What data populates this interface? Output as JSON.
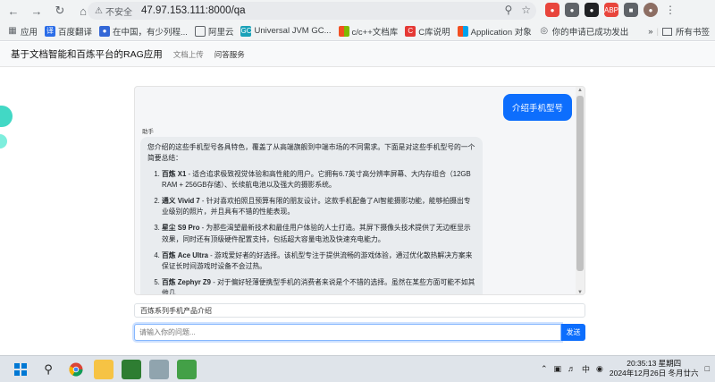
{
  "browser": {
    "insecure_label": "不安全",
    "url": "47.97.153.111:8000/qa"
  },
  "bookmarks": {
    "items": [
      {
        "label": "应用"
      },
      {
        "label": "百度翻译"
      },
      {
        "label": "在中国，有少列程..."
      },
      {
        "label": "阿里云"
      },
      {
        "label": "Universal JVM GC..."
      },
      {
        "label": "c/c++文档库"
      },
      {
        "label": "C库说明"
      },
      {
        "label": "Application 对象"
      },
      {
        "label": "你的申请已成功发出"
      }
    ],
    "all_bookmarks": "所有书签"
  },
  "app": {
    "title": "基于文档智能和百炼平台的RAG应用",
    "nav": [
      "文档上传",
      "问答服务"
    ]
  },
  "chat": {
    "user_message": "介绍手机型号",
    "sender": "助手",
    "intro": "您介绍的这些手机型号各具特色，覆盖了从高端旗舰到中端市场的不同需求。下面是对这些手机型号的一个简要总结：",
    "items": [
      {
        "name": "百炼 X1",
        "desc": " - 适合追求极致视觉体验和高性能的用户。它拥有6.7英寸高分辨率屏幕、大内存组合（12GB RAM + 256GB存储）、长续航电池以及强大的摄影系统。"
      },
      {
        "name": "通义 Vivid 7",
        "desc": " - 针对喜欢拍照且预算有限的朋友设计。这款手机配备了AI智能摄影功能，能够拍摄出专业级别的照片，并且具有不错的性能表现。"
      },
      {
        "name": "星尘 S9 Pro",
        "desc": " - 为那些渴望最新技术和最佳用户体验的人士打造。其屏下摄像头技术提供了无边框显示效果，同时还有顶级硬件配置支持，包括超大容量电池及快速充电能力。"
      },
      {
        "name": "百炼 Ace Ultra",
        "desc": " - 游戏爱好者的好选择。该机型专注于提供流畅的游戏体验，通过优化散热解决方案来保证长时间游戏时设备不会过热。"
      },
      {
        "name": "百炼 Zephyr Z9",
        "desc": " - 对于偏好轻薄便携型手机的消费者来说是个不错的选择。虽然在某些方面可能不如其他几"
      }
    ]
  },
  "suggestion": "百炼系列手机产品介绍",
  "input": {
    "placeholder": "请输入你的问题...",
    "send_label": "发送"
  },
  "taskbar": {
    "ime": "中",
    "time": "20:35:13 星期四",
    "date": "2024年12月26日 冬月廿六"
  },
  "colors": {
    "accent": "#0d6efd",
    "bubble_bot": "#e9ecef",
    "taskbar": "#dfe4ea"
  }
}
